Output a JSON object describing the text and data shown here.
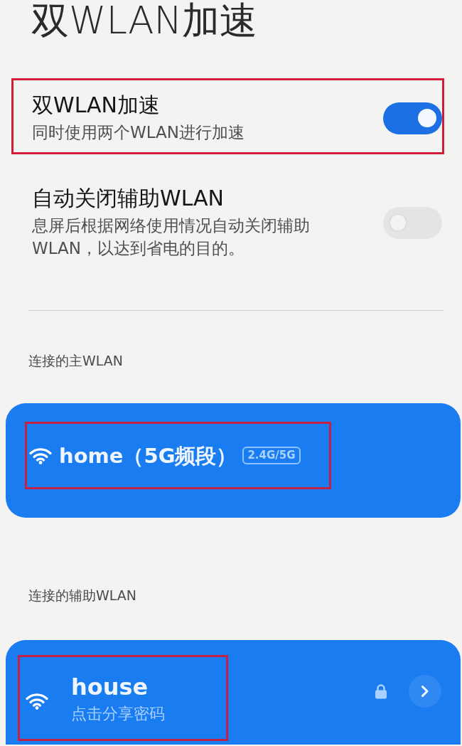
{
  "page": {
    "title": "双WLAN加速"
  },
  "settings": [
    {
      "title": "双WLAN加速",
      "description": "同时使用两个WLAN进行加速",
      "on": true,
      "highlighted": true
    },
    {
      "title": "自动关闭辅助WLAN",
      "description": "息屏后根据网络使用情况自动关闭辅助WLAN，以达到省电的目的。",
      "on": false,
      "highlighted": false
    }
  ],
  "sections": [
    {
      "label": "连接的主WLAN",
      "network": {
        "name": "home（5G频段）",
        "badge": "2.4G/5G",
        "highlighted": true,
        "locked": false,
        "details_button": false
      }
    },
    {
      "label": "连接的辅助WLAN",
      "network": {
        "name": "house",
        "subtitle": "点击分享密码",
        "highlighted": true,
        "locked": true,
        "details_button": true
      }
    }
  ]
}
